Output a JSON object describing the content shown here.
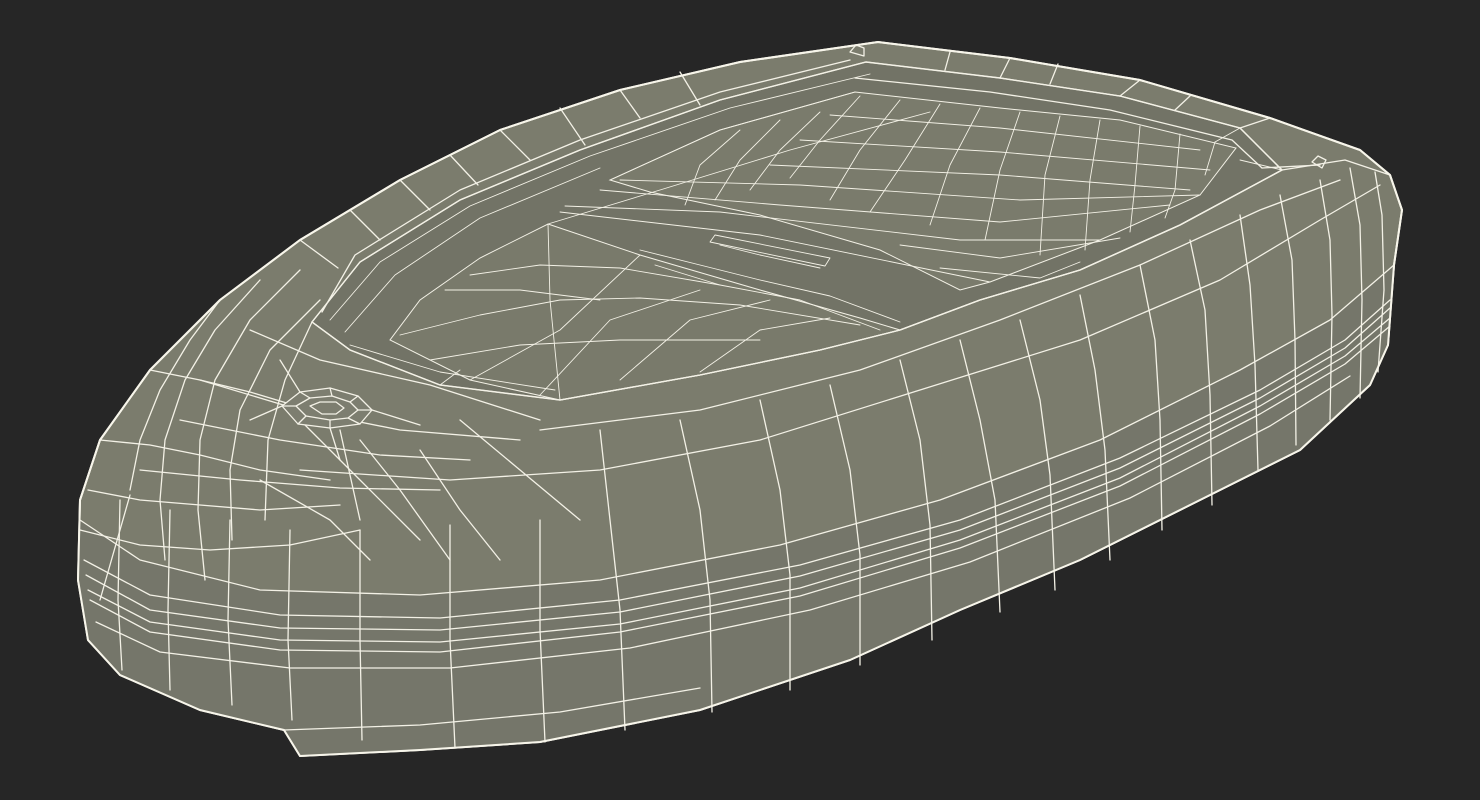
{
  "scene": {
    "subject": "3d-wireframe-render",
    "colors": {
      "background": "#262626",
      "surface": "#7b7c6d",
      "surface_top": "#818273",
      "surface_dark": "#6c6d60",
      "recess": "#727366",
      "wire": "#f3f1e6"
    }
  }
}
